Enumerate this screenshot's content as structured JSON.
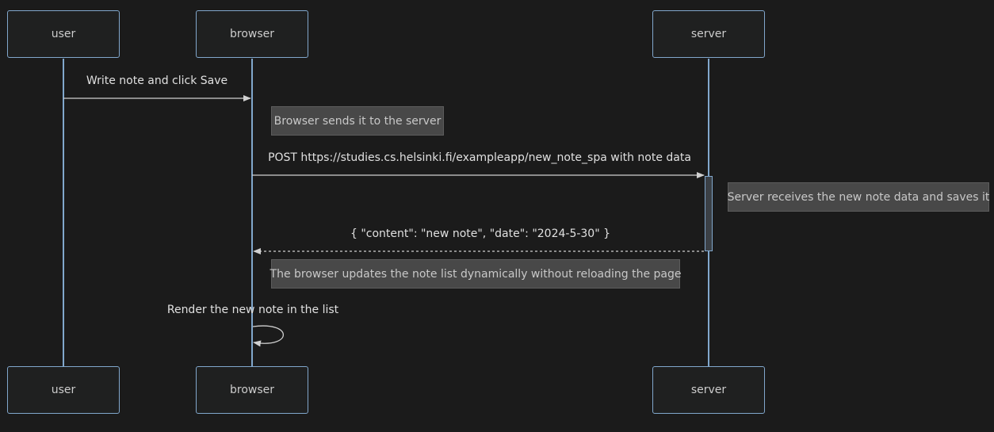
{
  "participants": [
    {
      "id": "user",
      "label": "user"
    },
    {
      "id": "browser",
      "label": "browser"
    },
    {
      "id": "server",
      "label": "server"
    }
  ],
  "messages": [
    {
      "from": "user",
      "to": "browser",
      "label": "Write note and click Save",
      "style": "solid"
    },
    {
      "from": "browser",
      "to": "server",
      "label": "POST https://studies.cs.helsinki.fi/exampleapp/new_note_spa with note data",
      "style": "solid"
    },
    {
      "from": "server",
      "to": "browser",
      "label": "{ \"content\": \"new note\", \"date\": \"2024-5-30\" }",
      "style": "dashed"
    },
    {
      "from": "browser",
      "to": "browser",
      "label": "Render the new note in the list",
      "style": "solid"
    }
  ],
  "notes": [
    {
      "text": "Browser sends it to the server"
    },
    {
      "text": "Server receives the new note data and saves it"
    },
    {
      "text": "The browser updates the note list dynamically without reloading the page"
    }
  ],
  "colors": {
    "background": "#1b1b1b",
    "line": "#81a7cc",
    "arrow": "#d0d0d0",
    "note_bg": "#484848"
  }
}
